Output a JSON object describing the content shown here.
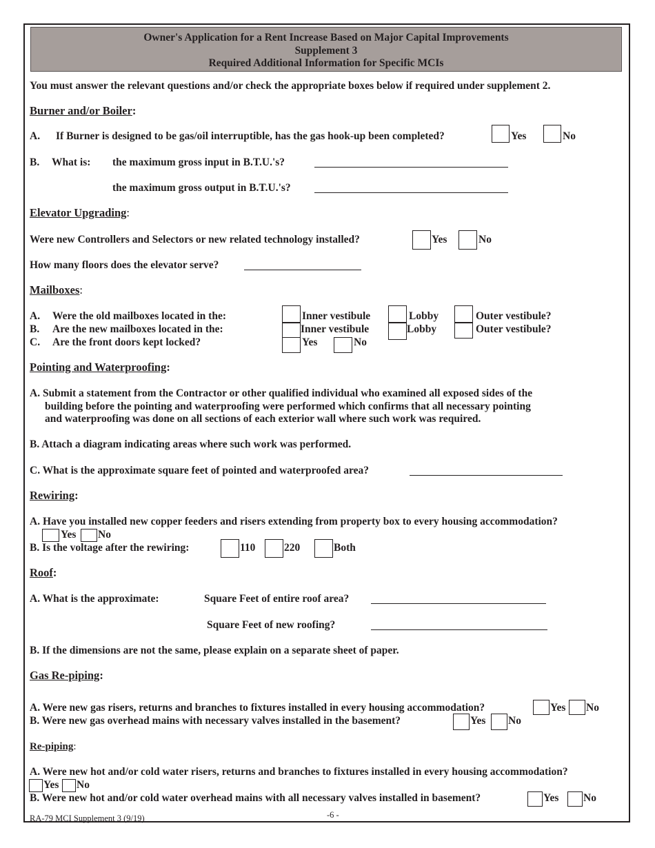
{
  "header": {
    "line1": "Owner's Application for a Rent Increase Based on Major Capital Improvements",
    "line2": "Supplement 3",
    "line3": "Required Additional Information for Specific MCIs"
  },
  "intro": "You must answer the relevant questions and/or check the appropriate boxes below if required under supplement 2.",
  "burner": {
    "title": "Burner and/or Boiler",
    "a_label": "A.",
    "a_text": "If Burner is designed to be gas/oil interruptible, has the gas hook-up been completed?",
    "yes": "Yes",
    "no": "No",
    "b_label": "B.",
    "b_what": "What is:",
    "b_input": "the maximum gross input in B.T.U.'s?",
    "b_output": "the maximum gross output in B.T.U.'s?",
    "input_value": "",
    "output_value": ""
  },
  "elevator": {
    "title": "Elevator Upgrading",
    "q1": "Were new Controllers and Selectors or new related technology installed?",
    "yes": "Yes",
    "no": "No",
    "q2": "How many floors does the elevator serve?",
    "floors_value": ""
  },
  "mailboxes": {
    "title": "Mailboxes",
    "a_label": "A.",
    "a_text": "Were the old mailboxes located in the:",
    "b_label": "B.",
    "b_text": "Are the new mailboxes located in the:",
    "c_label": "C.",
    "c_text": "Are the front doors kept locked?",
    "inner": "Inner vestibule",
    "lobby": "Lobby",
    "outer": "Outer vestibule?",
    "yes": "Yes",
    "no": "No"
  },
  "pointing": {
    "title": "Pointing and Waterproofing",
    "a_line1": "A. Submit a statement from the Contractor or other qualified individual who examined all exposed sides of the",
    "a_line2": "building before the pointing and waterproofing were performed which confirms that all necessary pointing",
    "a_line3": "and waterproofing was done on all sections of each exterior wall where such work was required.",
    "b_text": "B. Attach a diagram indicating areas where such work was performed.",
    "c_text": "C. What is the approximate square feet of pointed and waterproofed area?",
    "area_value": ""
  },
  "rewiring": {
    "title": "Rewiring",
    "a_text": "A. Have you installed new copper feeders and risers extending from property box to every housing accommodation?",
    "yes": "Yes",
    "no": "No",
    "b_text": "B. Is the voltage after the rewiring:",
    "v110": "110",
    "v220": "220",
    "both": "Both"
  },
  "roof": {
    "title": "Roof",
    "a_text": "A. What is the approximate:",
    "entire": "Square Feet of entire roof area?",
    "new": "Square Feet of new roofing?",
    "b_text": "B.  If the dimensions are not the same, please explain on a separate sheet of paper.",
    "entire_value": "",
    "new_value": ""
  },
  "gas": {
    "title": "Gas Re-piping",
    "a_text": "A.  Were new gas risers, returns and branches to fixtures installed in every housing accommodation?",
    "b_text": "B.  Were new gas overhead mains with necessary valves installed in the basement?",
    "yes": "Yes",
    "no": "No"
  },
  "repiping": {
    "title": "Re-piping",
    "a_text": "A. Were new hot and/or cold water risers, returns and branches to fixtures installed in every housing accommodation?",
    "b_text": "B. Were new hot and/or cold water overhead mains with all necessary valves installed in basement?",
    "yes": "Yes",
    "no": "No"
  },
  "footer": {
    "form_id": "RA-79 MCI Supplement 3 (9/19)",
    "page": "-6 -"
  }
}
